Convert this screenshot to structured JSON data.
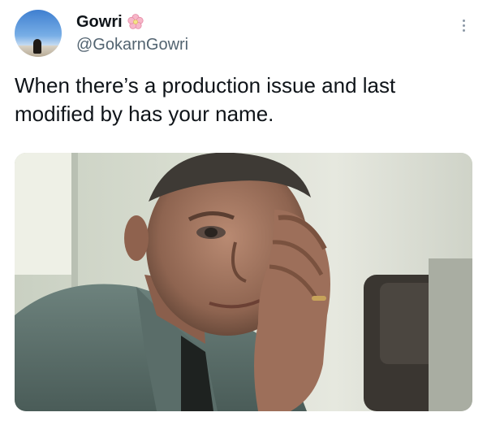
{
  "author": {
    "display_name": "Gowri",
    "handle": "@GokarnGowri",
    "badge_icon": "cherry-blossom-icon"
  },
  "tweet": {
    "text": "When there’s a production issue and last modified by has your name."
  },
  "media": {
    "type": "image",
    "subject": "man-with-hand-on-forehead"
  },
  "colors": {
    "text": "#0f1419",
    "secondary": "#536471",
    "icon": "#8b98a5"
  },
  "icons": {
    "more": "more-options-icon"
  }
}
